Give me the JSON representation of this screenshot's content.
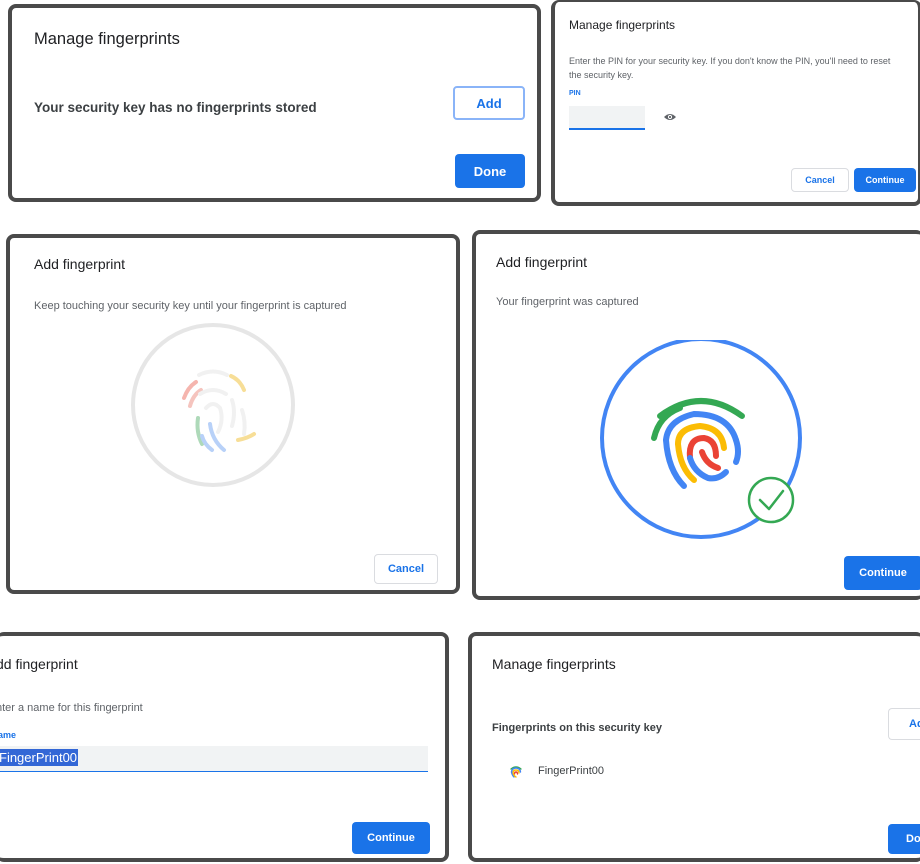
{
  "panel1": {
    "title": "Manage fingerprints",
    "message": "Your security key has no fingerprints stored",
    "add_label": "Add",
    "done_label": "Done"
  },
  "panel2": {
    "title": "Manage fingerprints",
    "description_line1": "Enter the PIN for your security key. If you don't know the PIN, you'll need to reset",
    "description_line2": "the security key.",
    "pin_label": "PIN",
    "pin_value": "",
    "visibility_icon": "eye-icon",
    "cancel_label": "Cancel",
    "continue_label": "Continue"
  },
  "panel3": {
    "title": "Add fingerprint",
    "description": "Keep touching your security key until your fingerprint is captured",
    "cancel_label": "Cancel",
    "icon": "fingerprint-progress-icon"
  },
  "panel4": {
    "title": "Add fingerprint",
    "description": "Your fingerprint was captured",
    "continue_label": "Continue",
    "icon": "fingerprint-captured-icon",
    "check_icon": "checkmark-icon"
  },
  "panel5": {
    "title": "dd fingerprint",
    "description": "nter a name for this fingerprint",
    "name_label": "ame",
    "name_value": "FingerPrint00",
    "continue_label": "Continue"
  },
  "panel6": {
    "title": "Manage fingerprints",
    "section_label": "Fingerprints on this security key",
    "fingerprint_name": "FingerPrint00",
    "add_label": "Ad",
    "done_label": "Do"
  },
  "colors": {
    "accent": "#1a73e8",
    "google_blue": "#4285f4",
    "google_red": "#ea4335",
    "google_yellow": "#fbbc04",
    "google_green": "#34a853",
    "frame": "#4a4a4a"
  }
}
